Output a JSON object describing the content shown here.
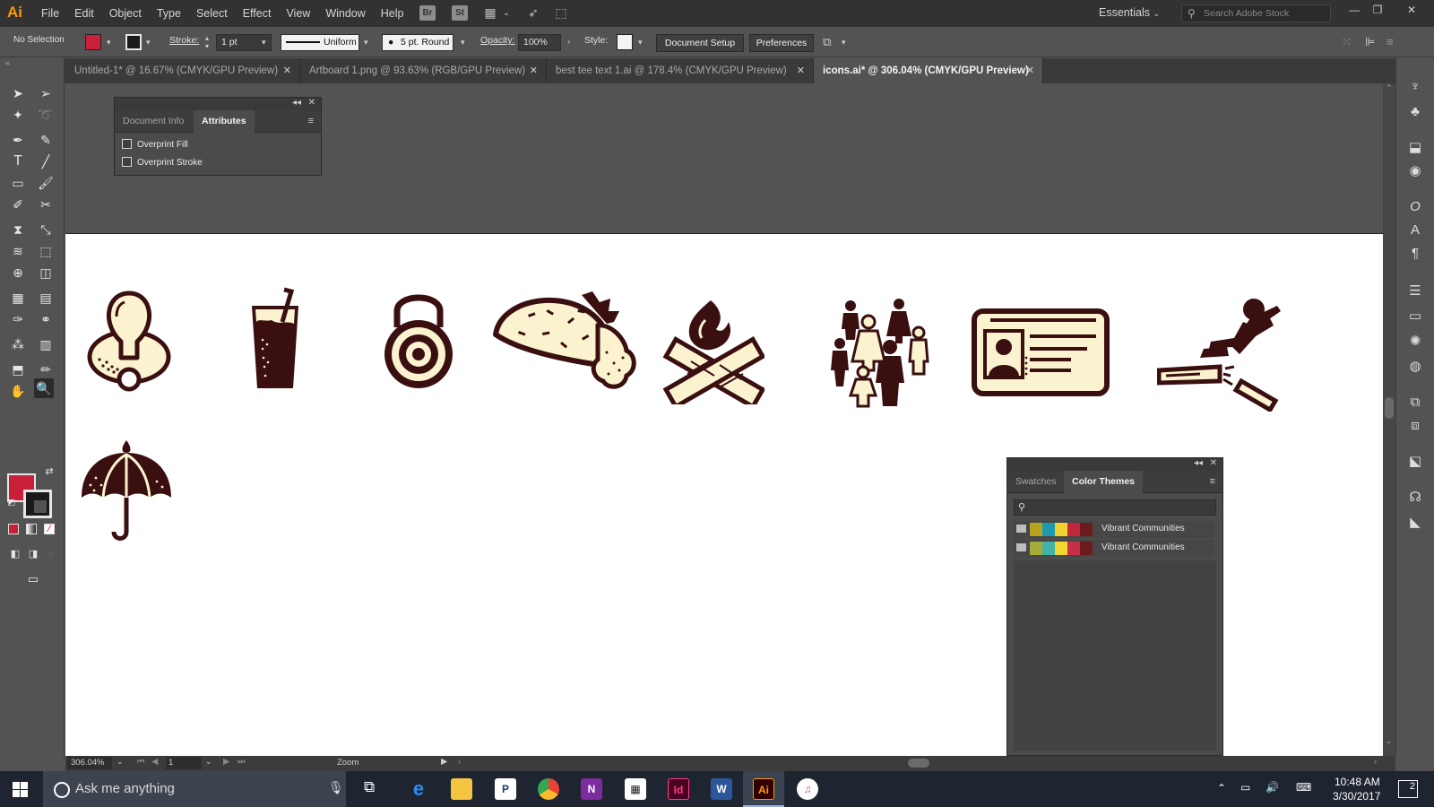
{
  "app": {
    "logo": "Ai"
  },
  "menu": {
    "items": [
      "File",
      "Edit",
      "Object",
      "Type",
      "Select",
      "Effect",
      "View",
      "Window",
      "Help"
    ]
  },
  "menubar_icons": {
    "bridge": "Br",
    "stock": "St"
  },
  "workspace": {
    "label": "Essentials"
  },
  "search": {
    "placeholder": "Search Adobe Stock"
  },
  "control": {
    "selection": "No Selection",
    "stroke_label": "Stroke:",
    "stroke_weight": "1 pt",
    "profile": "Uniform",
    "brush": "5 pt. Round",
    "opacity_label": "Opacity:",
    "opacity": "100%",
    "style_label": "Style:",
    "document_setup": "Document Setup",
    "preferences": "Preferences"
  },
  "tabs": [
    {
      "label": "Untitled-1* @ 16.67% (CMYK/GPU Preview)"
    },
    {
      "label": "Artboard 1.png @ 93.63% (RGB/GPU Preview)"
    },
    {
      "label": "best tee text 1.ai @ 178.4% (CMYK/GPU Preview)"
    },
    {
      "label": "icons.ai* @ 306.04% (CMYK/GPU Preview)"
    }
  ],
  "attributes_panel": {
    "tabs": [
      "Document Info",
      "Attributes"
    ],
    "options": [
      "Overprint Fill",
      "Overprint Stroke"
    ]
  },
  "themes_panel": {
    "tabs": [
      "Swatches",
      "Color Themes"
    ],
    "themes": [
      {
        "name": "Vibrant Communities",
        "colors": [
          "#b5a320",
          "#1e9ab0",
          "#f2d22e",
          "#c0273c",
          "#6b1a1e"
        ]
      },
      {
        "name": "Vibrant Communities",
        "colors": [
          "#a5ab38",
          "#41b3a8",
          "#f3d72e",
          "#c62f46",
          "#6b1a1e"
        ]
      }
    ]
  },
  "status": {
    "zoom": "306.04%",
    "page": "1",
    "tool": "Zoom"
  },
  "taskbar": {
    "search": "Ask me anything",
    "time": "10:48 AM",
    "date": "3/30/2017",
    "notifications": "2"
  },
  "colors": {
    "fill": "#c8203a",
    "icon_dark": "#3a0f10",
    "icon_cream": "#fbf3cf"
  }
}
